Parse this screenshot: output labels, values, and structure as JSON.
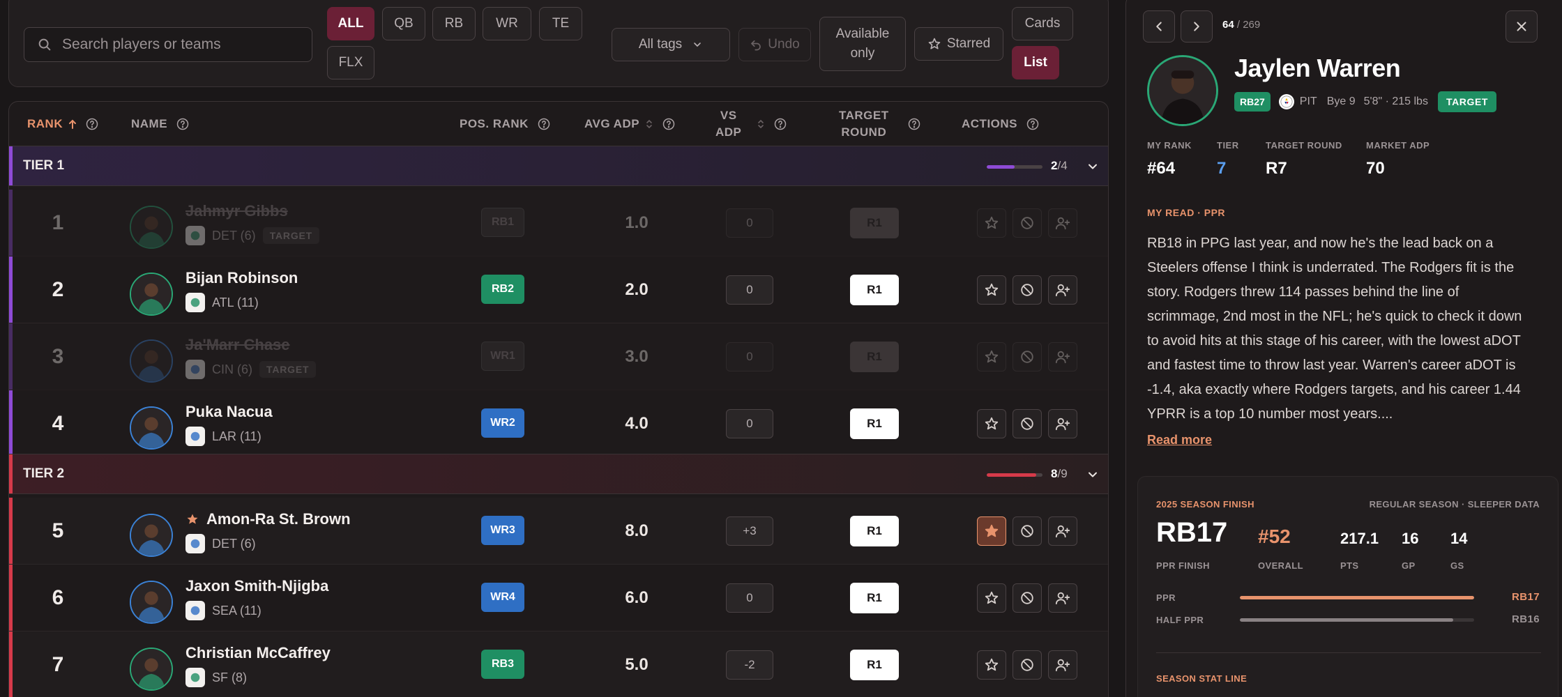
{
  "search": {
    "placeholder": "Search players or teams"
  },
  "positions": [
    {
      "label": "ALL",
      "active": true
    },
    {
      "label": "QB"
    },
    {
      "label": "RB"
    },
    {
      "label": "WR"
    },
    {
      "label": "TE"
    },
    {
      "label": "FLX"
    }
  ],
  "filters": {
    "tags_label": "All tags",
    "undo_label": "Undo",
    "available_line1": "Available",
    "available_line2": "only",
    "starred_label": "Starred",
    "cards_label": "Cards",
    "list_label": "List"
  },
  "columns": {
    "rank": "RANK",
    "name": "NAME",
    "pos_rank": "POS. RANK",
    "avg_adp": "AVG ADP",
    "vs_adp_1": "VS",
    "vs_adp_2": "ADP",
    "target_round_1": "TARGET",
    "target_round_2": "ROUND",
    "actions": "ACTIONS"
  },
  "tiers": [
    {
      "name": "TIER 1",
      "done": "2",
      "total": "4",
      "fraction": 0.5,
      "color": "#8e4bd6"
    },
    {
      "name": "TIER 2",
      "done": "8",
      "total": "9",
      "fraction": 0.89,
      "color": "#d63a4a"
    }
  ],
  "colors": {
    "rb": "#1f8f63",
    "wr": "#2f6fc4",
    "accent": "#e8936c",
    "burgundy": "#6b2036"
  },
  "players": [
    {
      "rank": "1",
      "name": "Jahmyr Gibbs",
      "team": "DET (6)",
      "tag": "TARGET",
      "pos": "RB1",
      "adp": "1.0",
      "vs": "0",
      "round": "R1",
      "drafted": true,
      "tier": 0
    },
    {
      "rank": "2",
      "name": "Bijan Robinson",
      "team": "ATL (11)",
      "pos": "RB2",
      "adp": "2.0",
      "vs": "0",
      "round": "R1",
      "tier": 0
    },
    {
      "rank": "3",
      "name": "Ja'Marr Chase",
      "team": "CIN (6)",
      "tag": "TARGET",
      "pos": "WR1",
      "adp": "3.0",
      "vs": "0",
      "round": "R1",
      "drafted": true,
      "tier": 0
    },
    {
      "rank": "4",
      "name": "Puka Nacua",
      "team": "LAR (11)",
      "pos": "WR2",
      "adp": "4.0",
      "vs": "0",
      "round": "R1",
      "tier": 0
    },
    {
      "rank": "5",
      "name": "Amon-Ra St. Brown",
      "team": "DET (6)",
      "pos": "WR3",
      "adp": "8.0",
      "vs": "+3",
      "round": "R1",
      "starred": true,
      "tier": 1
    },
    {
      "rank": "6",
      "name": "Jaxon Smith-Njigba",
      "team": "SEA (11)",
      "pos": "WR4",
      "adp": "6.0",
      "vs": "0",
      "round": "R1",
      "tier": 1
    },
    {
      "rank": "7",
      "name": "Christian McCaffrey",
      "team": "SF (8)",
      "pos": "RB3",
      "adp": "5.0",
      "vs": "-2",
      "round": "R1",
      "tier": 1
    }
  ],
  "panel": {
    "index": "64",
    "total": "269",
    "name": "Jaylen Warren",
    "pos_badge": "RB27",
    "team": "PIT",
    "bye": "Bye 9",
    "size": "5'8\" · 215 lbs",
    "target_badge": "TARGET",
    "stats": [
      {
        "label": "MY RANK",
        "value": "#64"
      },
      {
        "label": "TIER",
        "value": "7"
      },
      {
        "label": "TARGET ROUND",
        "value": "R7"
      },
      {
        "label": "MARKET ADP",
        "value": "70"
      }
    ],
    "read_label": "MY READ · PPR",
    "read_text": "RB18 in PPG last year, and now he's the lead back on a Steelers offense I think is underrated. The Rodgers fit is the story. Rodgers threw 114 passes behind the line of scrimmage, 2nd most in the NFL; he's quick to check it down to avoid hits at this stage of his career, with the lowest aDOT and fastest time to throw last year. Warren's career aDOT is -1.4, aka exactly where Rodgers targets, and his career 1.44 YPRR is a top 10 number most years....",
    "read_more": "Read more",
    "season": {
      "title": "2025 SEASON FINISH",
      "source": "REGULAR SEASON · SLEEPER DATA",
      "finish": "RB17",
      "finish_label": "PPR FINISH",
      "overall": "#52",
      "overall_label": "OVERALL",
      "pts": "217.1",
      "pts_label": "PTS",
      "gp": "16",
      "gp_label": "GP",
      "gs": "14",
      "gs_label": "GS",
      "bars": [
        {
          "label": "PPR",
          "value": "RB17",
          "fraction": 1.0
        },
        {
          "label": "HALF PPR",
          "value": "RB16",
          "fraction": 0.91
        }
      ],
      "statline_label": "SEASON STAT LINE"
    }
  }
}
